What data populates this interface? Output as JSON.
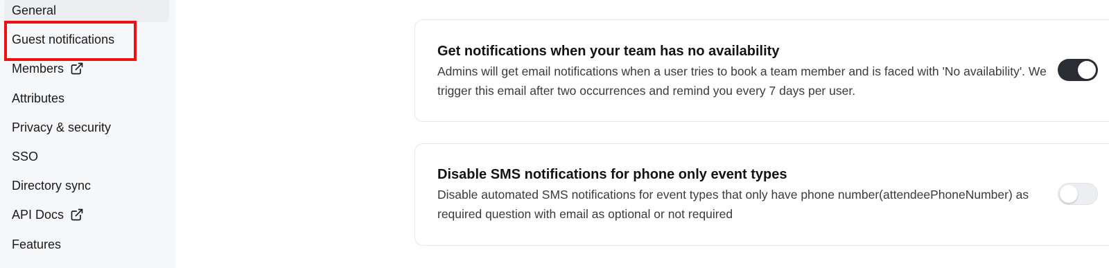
{
  "sidebar": {
    "items": [
      {
        "label": "General"
      },
      {
        "label": "Guest notifications"
      },
      {
        "label": "Members",
        "external": true
      },
      {
        "label": "Attributes"
      },
      {
        "label": "Privacy & security"
      },
      {
        "label": "SSO"
      },
      {
        "label": "Directory sync"
      },
      {
        "label": "API Docs",
        "external": true
      },
      {
        "label": "Features"
      }
    ],
    "highlighted_item": "Guest notifications"
  },
  "settings": [
    {
      "title": "Get notifications when your team has no availability",
      "description": "Admins will get email notifications when a user tries to book a team member and is faced with 'No availability'. We trigger this email after two occurrences and remind you every 7 days per user.",
      "enabled": true
    },
    {
      "title": "Disable SMS notifications for phone only event types",
      "description": "Disable automated SMS notifications for event types that only have phone number(attendeePhoneNumber) as required question with email as optional or not required",
      "enabled": false
    }
  ],
  "colors": {
    "highlight": "#ee1111",
    "toggle_on": "#2a2d33",
    "toggle_off": "#eceef1"
  },
  "icons": {
    "external_link": "external-link-icon"
  }
}
